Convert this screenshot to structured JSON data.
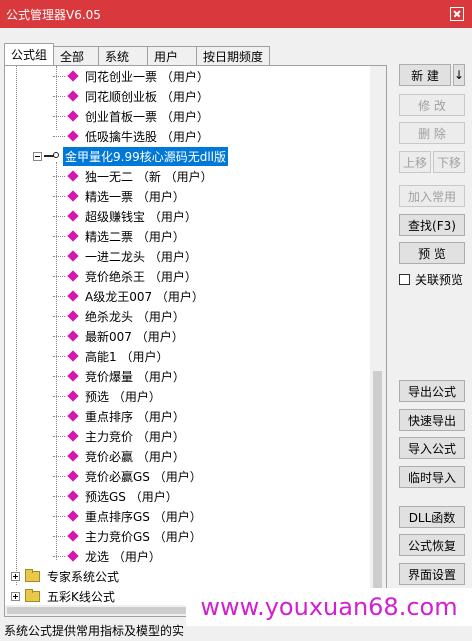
{
  "window": {
    "title": "公式管理器V6.05"
  },
  "tabs": [
    {
      "label": "公式组",
      "active": true
    },
    {
      "label": "全部"
    },
    {
      "label": "系统"
    },
    {
      "label": "用户"
    },
    {
      "label": "按日期频度"
    }
  ],
  "tree": {
    "top_items": [
      {
        "label": "同花创业一票 （用户）"
      },
      {
        "label": "同花顺创业板 （用户）"
      },
      {
        "label": "创业首板一票 （用户）"
      },
      {
        "label": "低吸擒牛选股 （用户）"
      }
    ],
    "group": {
      "label": "金甲量化9.99核心源码无dll版"
    },
    "group_items": [
      {
        "label": "独一无二 （新 （用户）"
      },
      {
        "label": "精选一票 （用户）"
      },
      {
        "label": "超级赚钱宝 （用户）"
      },
      {
        "label": "精选二票 （用户）"
      },
      {
        "label": "一进二龙头 （用户）"
      },
      {
        "label": "竞价绝杀王 （用户）"
      },
      {
        "label": "A级龙王007 （用户）"
      },
      {
        "label": "绝杀龙头 （用户）"
      },
      {
        "label": "最新007 （用户）"
      },
      {
        "label": "高能1 （用户）"
      },
      {
        "label": "竞价爆量 （用户）"
      },
      {
        "label": "预选 （用户）"
      },
      {
        "label": "重点排序 （用户）"
      },
      {
        "label": "主力竞价 （用户）"
      },
      {
        "label": "竞价必赢 （用户）"
      },
      {
        "label": "竞价必赢GS （用户）"
      },
      {
        "label": "预选GS （用户）"
      },
      {
        "label": "重点排序GS （用户）"
      },
      {
        "label": "主力竞价GS （用户）"
      },
      {
        "label": "龙选 （用户）"
      }
    ],
    "folders": [
      {
        "label": "专家系统公式"
      },
      {
        "label": "五彩K线公式"
      }
    ]
  },
  "buttons": {
    "new": "新 建",
    "new_arrow": "↓",
    "modify": "修 改",
    "delete": "删 除",
    "move_up": "上移",
    "move_down": "下移",
    "add_common": "加入常用",
    "find": "查找(F3)",
    "preview": "预 览",
    "linked_preview": "关联预览",
    "export": "导出公式",
    "quick_export": "快速导出",
    "import": "导入公式",
    "temp_import": "临时导入",
    "dll": "DLL函数",
    "restore": "公式恢复",
    "page_setup": "界面设置"
  },
  "status": {
    "text": "系统公式提供常用指标及模型的实"
  },
  "watermark": {
    "text": "www.youxuan68.com"
  }
}
